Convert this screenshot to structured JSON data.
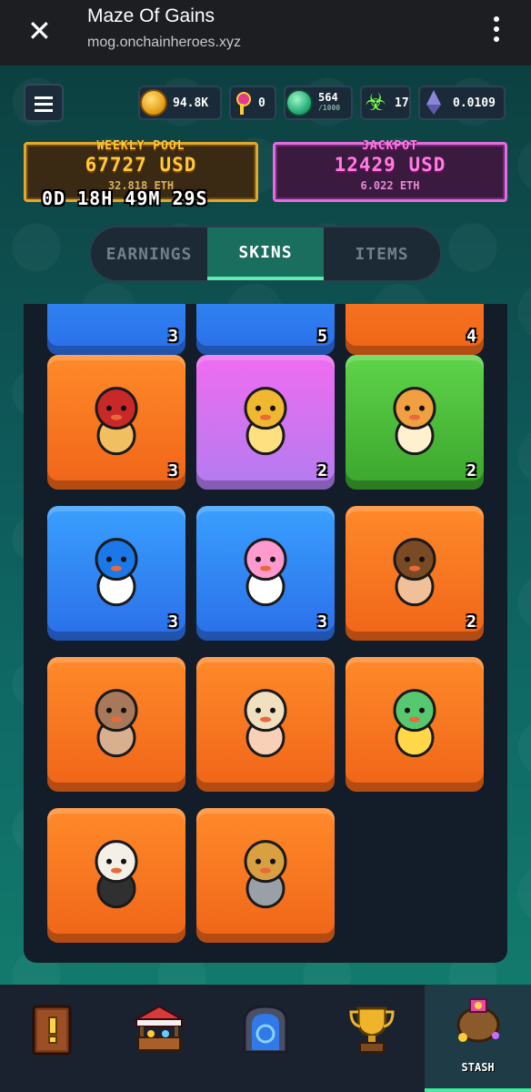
{
  "browser": {
    "title": "Maze Of Gains",
    "url": "mog.onchainheroes.xyz"
  },
  "stats": {
    "coins": "94.8K",
    "keys": "0",
    "gems": "564",
    "gems_max": "/1000",
    "energy": "17",
    "eth": "0.0109"
  },
  "weekly_pool": {
    "label": "WEEKLY POOL",
    "usd": "67727 USD",
    "eth": "32.818 ETH",
    "timer": "0D 18H 49M 29S"
  },
  "jackpot": {
    "label": "JACKPOT",
    "usd": "12429 USD",
    "eth": "6.022 ETH"
  },
  "tabs": [
    "EARNINGS",
    "SKINS",
    "ITEMS"
  ],
  "active_tab": "SKINS",
  "skins": [
    {
      "name": "partial-skin-blue-1",
      "color": "blue",
      "count": "3"
    },
    {
      "name": "partial-skin-blue-2",
      "color": "blue",
      "count": "5"
    },
    {
      "name": "partial-skin-orange",
      "color": "orange",
      "count": "4"
    },
    {
      "name": "red-horse-skin",
      "color": "orange",
      "count": "3"
    },
    {
      "name": "golden-cat-skin",
      "color": "purple",
      "count": "2"
    },
    {
      "name": "orange-cat-skin",
      "color": "green",
      "count": "2"
    },
    {
      "name": "blue-penguin-skin",
      "color": "blue",
      "count": "3"
    },
    {
      "name": "pink-penguin-skin",
      "color": "blue",
      "count": "3"
    },
    {
      "name": "brown-hair-kid-skin",
      "color": "orange",
      "count": "2"
    },
    {
      "name": "brown-chick-skin",
      "color": "orange",
      "count": ""
    },
    {
      "name": "hat-kid-skin",
      "color": "orange",
      "count": ""
    },
    {
      "name": "green-frog-skin",
      "color": "orange",
      "count": ""
    },
    {
      "name": "white-sheep-skin",
      "color": "orange",
      "count": ""
    },
    {
      "name": "straw-hat-cat-skin",
      "color": "orange",
      "count": ""
    }
  ],
  "nav": [
    {
      "name": "quest-book",
      "label": ""
    },
    {
      "name": "shop",
      "label": ""
    },
    {
      "name": "portal",
      "label": ""
    },
    {
      "name": "trophy",
      "label": ""
    },
    {
      "name": "stash",
      "label": "STASH"
    }
  ],
  "colors": {
    "orange_card": "#f06418",
    "blue_card": "#2a6ee8",
    "purple_card": "#b27cf0",
    "green_card": "#3aa52c",
    "active_tab": "#1a6e5e"
  }
}
